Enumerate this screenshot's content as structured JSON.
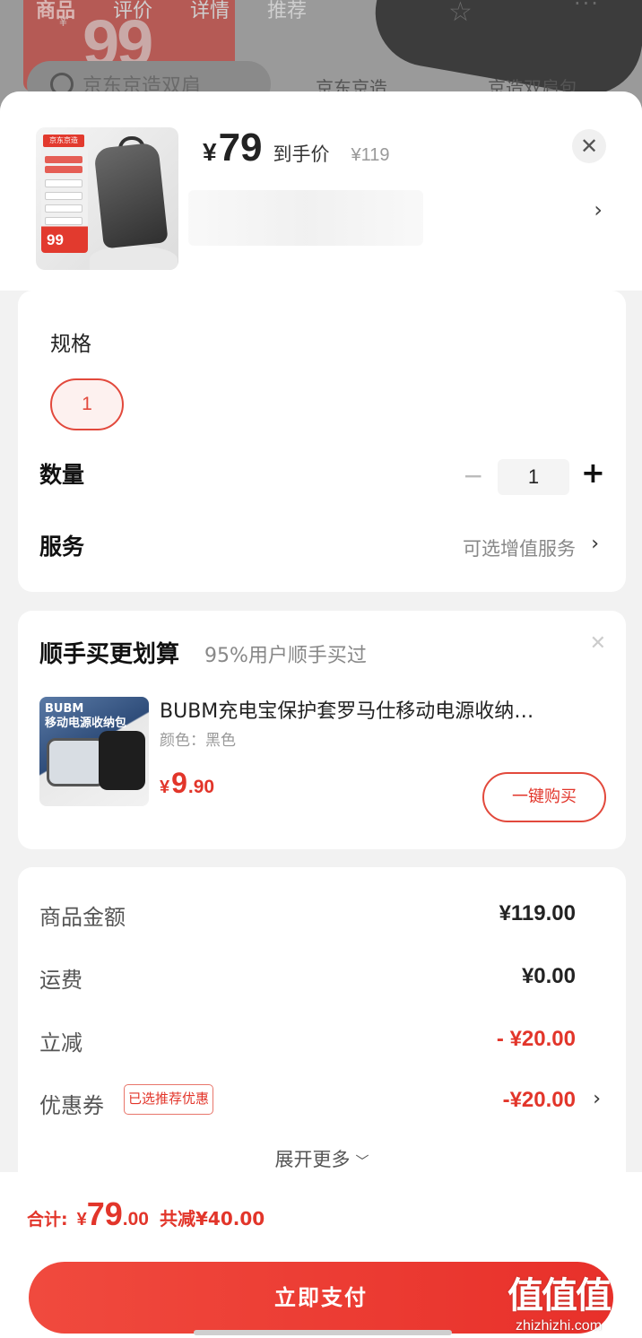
{
  "background_page": {
    "tabs": [
      "商品",
      "评价",
      "详情",
      "推荐"
    ],
    "promo_yen": "¥",
    "promo_price": "99",
    "search_text": "京东京造双肩",
    "related": [
      "京东京造…",
      "京造双肩包"
    ]
  },
  "product": {
    "thumb_brand": "京东京造",
    "thumb_price": "99",
    "currency": "¥",
    "price": "79",
    "price_tag": "到手价",
    "original_price": "¥119"
  },
  "spec": {
    "label": "规格",
    "selected": "1"
  },
  "quantity": {
    "label": "数量",
    "minus": "−",
    "value": "1",
    "plus": "+"
  },
  "service": {
    "label": "服务",
    "value": "可选增值服务"
  },
  "addon": {
    "title": "顺手买更划算",
    "subtitle": "95%用户顺手买过",
    "image_text": "BUBM\n移动电源收纳包",
    "name": "BUBM充电宝保护套罗马仕移动电源收纳…",
    "color": "颜色：黑色",
    "price_yen": "¥",
    "price_int": "9",
    "price_dec": ".90",
    "buy_label": "一键购买"
  },
  "fees": {
    "goods_label": "商品金额",
    "goods_value": "¥119.00",
    "shipping_label": "运费",
    "shipping_value": "¥0.00",
    "discount_label": "立减",
    "discount_value": "- ¥20.00",
    "coupon_label": "优惠券",
    "coupon_tag": "已选推荐优惠",
    "coupon_value": "-¥20.00",
    "more_label": "展开更多"
  },
  "footer": {
    "total_label": "合计:",
    "total_yen": "¥",
    "total_int": "79",
    "total_dec": ".00",
    "saved": "共减¥40.00",
    "pay_label": "立即支付"
  },
  "watermark": {
    "big": "值值值",
    "small": "zhizhizhi.com"
  },
  "colors": {
    "accent": "#e2352a",
    "chip_bg": "#fdf1ef"
  }
}
